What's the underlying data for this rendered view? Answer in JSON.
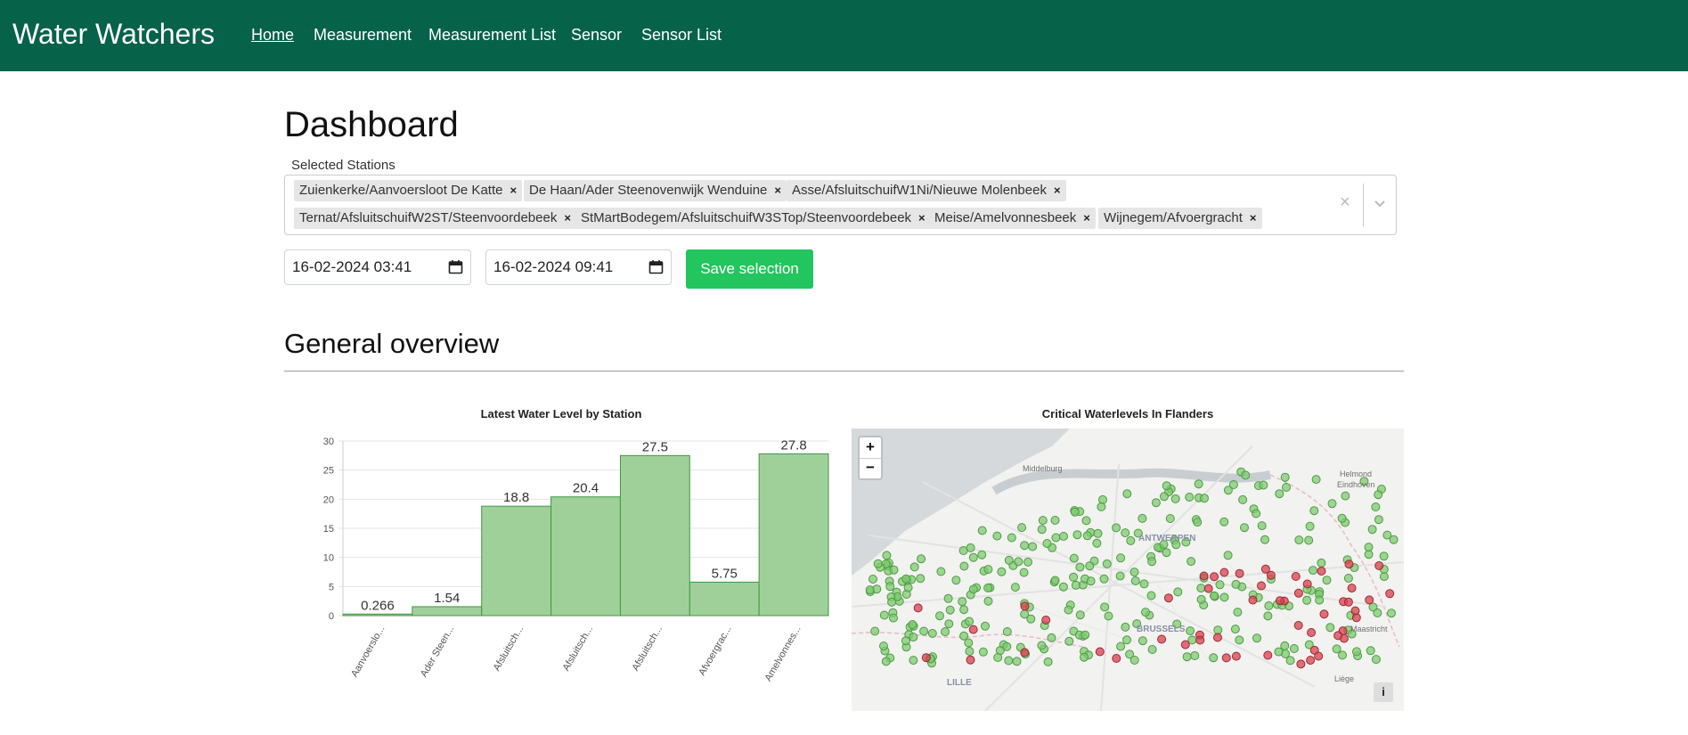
{
  "navbar": {
    "brand": "Water Watchers",
    "links": [
      "Home",
      "Measurement",
      "Measurement List",
      "Sensor",
      "Sensor List"
    ],
    "active": "Home",
    "color": "#07624a"
  },
  "page": {
    "title": "Dashboard"
  },
  "selection": {
    "label": "Selected Stations",
    "chips": [
      "Zuienkerke/Aanvoersloot De Katte",
      "De Haan/Ader Steenovenwijk Wenduine",
      "Asse/AfsluitschuifW1Ni/Nieuwe Molenbeek",
      "Ternat/AfsluitschuifW2ST/Steenvoordebeek",
      "StMartBodegem/AfsluitschuifW3STop/Steenvoordebeek",
      "Meise/Amelvonnesbeek",
      "Wijnegem/Afvoergracht"
    ],
    "remove_glyph": "×",
    "clear_glyph": "×",
    "start_value": "16-02-2024 03:41",
    "end_value": "16-02-2024 09:41",
    "save_label": "Save selection",
    "save_color": "#22c55e"
  },
  "overview": {
    "title": "General overview"
  },
  "bar_chart": {
    "title": "Latest Water Level by Station"
  },
  "map": {
    "title": "Critical Waterlevels In Flanders",
    "zoom_in": "+",
    "zoom_out": "−",
    "info": "i",
    "city_labels": [
      "Middelburg",
      "Helmond",
      "Eindhoven",
      "ANTWERPEN",
      "BRUSSELS",
      "Maastricht",
      "Liège",
      "LILLE"
    ],
    "ok_color": "#7dcb6f",
    "critical_color": "#d9404e"
  },
  "chart_data": {
    "type": "bar",
    "title": "Latest Water Level by Station",
    "categories": [
      "Aanvoerslo...",
      "Ader Steen...",
      "Afsluitsch...",
      "Afsluitsch...",
      "Afsluitsch...",
      "Afvoergrac...",
      "Amelvonnes..."
    ],
    "values": [
      0.266,
      1.54,
      18.8,
      20.4,
      27.5,
      5.75,
      27.8
    ],
    "value_labels": [
      "0.266",
      "1.54",
      "18.8",
      "20.4",
      "27.5",
      "5.75",
      "27.8"
    ],
    "yticks": [
      "0",
      "5",
      "10",
      "15",
      "20",
      "25",
      "30"
    ],
    "ylim": [
      0,
      30
    ],
    "xlabel": "",
    "ylabel": "",
    "grid": true,
    "bar_color": "#9fd09a",
    "bar_border": "#3e9a3e"
  }
}
